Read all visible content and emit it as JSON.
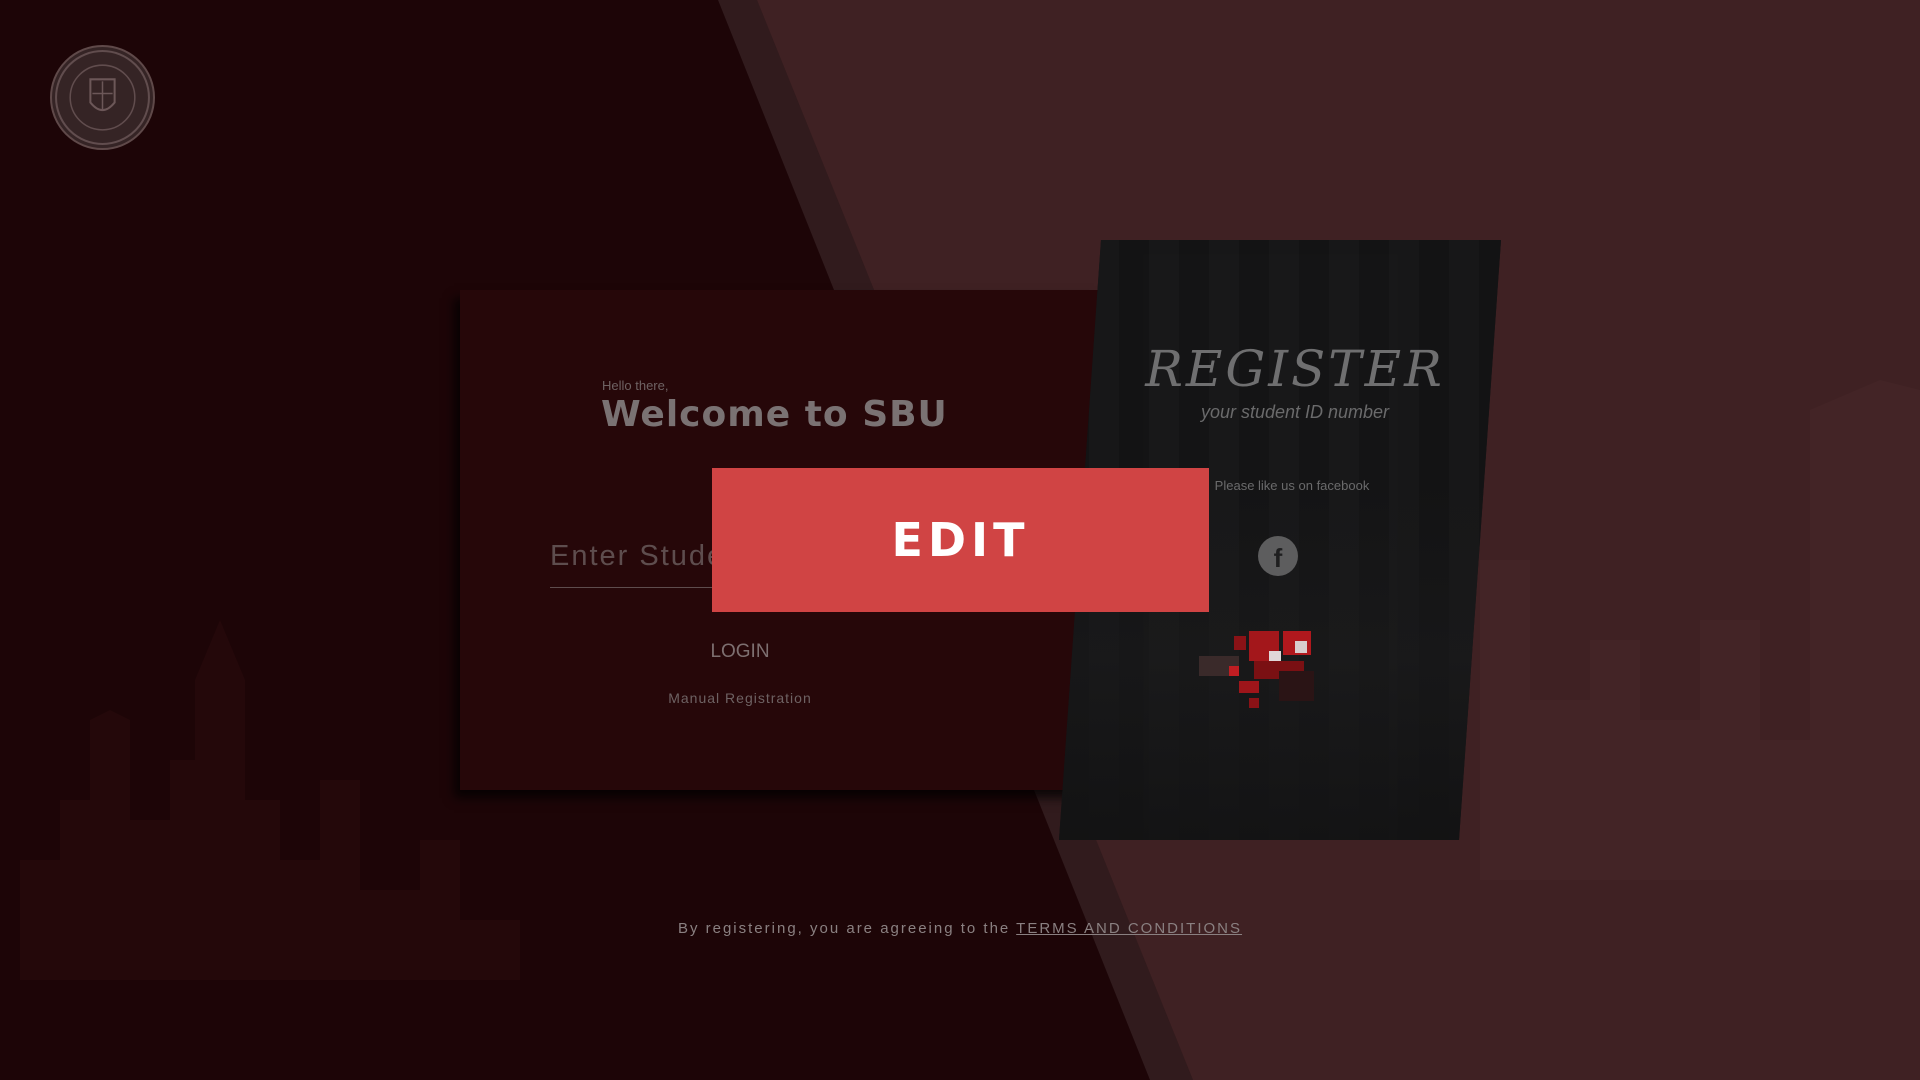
{
  "login": {
    "greeting": "Hello there,",
    "welcome": "Welcome to SBU",
    "input_placeholder": "Enter Student ID",
    "login_label": "LOGIN",
    "manual_label": "Manual Registration"
  },
  "register": {
    "title": "REGISTER",
    "subtitle": "your student ID number",
    "facebook_text": "Please like us on facebook",
    "facebook_icon": "facebook-icon"
  },
  "footer": {
    "text": "By registering, you are agreeing to the ",
    "terms_label": "TERMS AND CONDITIONS"
  },
  "overlay": {
    "edit_label": "EDIT"
  },
  "colors": {
    "edit_accent": "#d04444",
    "background_dark": "#1d0507",
    "background_light": "#3f2123"
  }
}
